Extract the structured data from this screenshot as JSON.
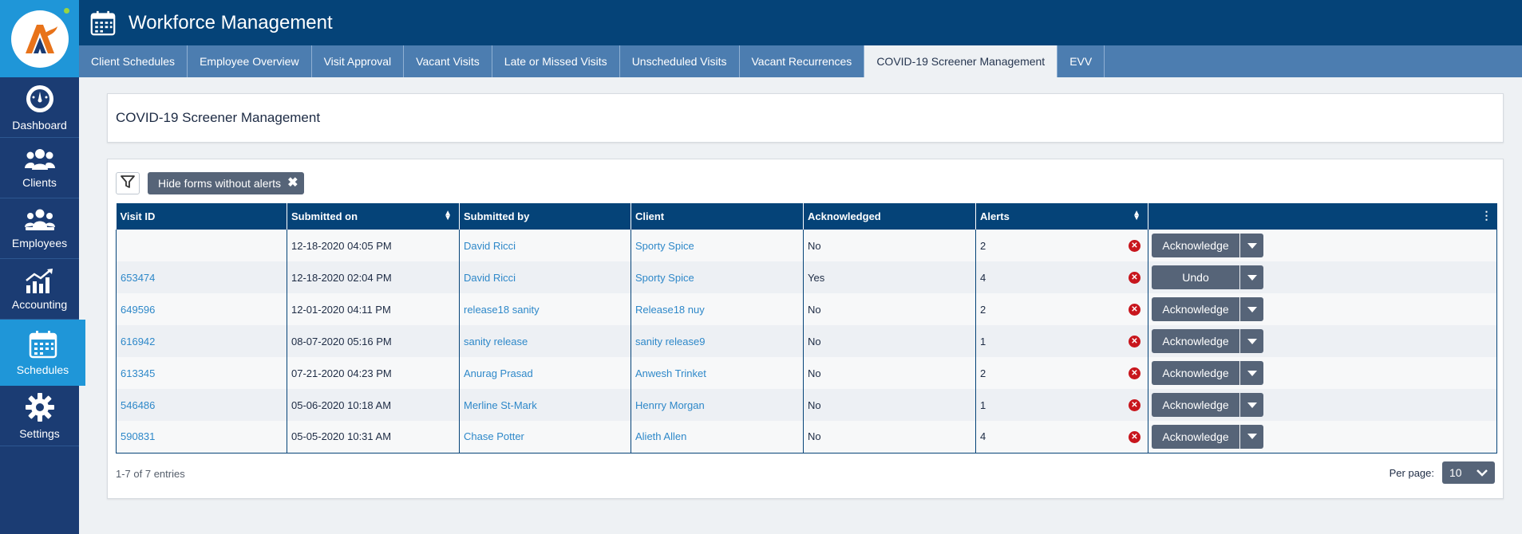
{
  "app": {
    "title": "Workforce Management"
  },
  "sidebar": {
    "items": [
      {
        "label": "Dashboard",
        "icon": "dashboard-gauge-icon"
      },
      {
        "label": "Clients",
        "icon": "clients-group-icon"
      },
      {
        "label": "Employees",
        "icon": "employees-group-icon"
      },
      {
        "label": "Accounting",
        "icon": "accounting-chart-icon"
      },
      {
        "label": "Schedules",
        "icon": "calendar-icon",
        "active": true
      },
      {
        "label": "Settings",
        "icon": "gear-icon"
      }
    ]
  },
  "tabs": [
    {
      "label": "Client Schedules"
    },
    {
      "label": "Employee Overview"
    },
    {
      "label": "Visit Approval"
    },
    {
      "label": "Vacant Visits"
    },
    {
      "label": "Late or Missed Visits"
    },
    {
      "label": "Unscheduled Visits"
    },
    {
      "label": "Vacant Recurrences"
    },
    {
      "label": "COVID-19 Screener Management",
      "active": true
    },
    {
      "label": "EVV"
    }
  ],
  "page": {
    "title": "COVID-19 Screener Management"
  },
  "filter": {
    "chip_label": "Hide forms without alerts",
    "chip_close": "✖"
  },
  "table": {
    "columns": [
      "Visit ID",
      "Submitted on",
      "Submitted by",
      "Client",
      "Acknowledged",
      "Alerts",
      ""
    ],
    "rows": [
      {
        "visit_id": "",
        "submitted_on": "12-18-2020 04:05 PM",
        "submitted_by": "David Ricci",
        "client": "Sporty Spice",
        "acknowledged": "No",
        "alerts": "2",
        "action": "Acknowledge"
      },
      {
        "visit_id": "653474",
        "submitted_on": "12-18-2020 02:04 PM",
        "submitted_by": "David Ricci",
        "client": "Sporty Spice",
        "acknowledged": "Yes",
        "alerts": "4",
        "action": "Undo"
      },
      {
        "visit_id": "649596",
        "submitted_on": "12-01-2020 04:11 PM",
        "submitted_by": "release18 sanity",
        "client": "Release18 nuy",
        "acknowledged": "No",
        "alerts": "2",
        "action": "Acknowledge"
      },
      {
        "visit_id": "616942",
        "submitted_on": "08-07-2020 05:16 PM",
        "submitted_by": "sanity release",
        "client": "sanity release9",
        "acknowledged": "No",
        "alerts": "1",
        "action": "Acknowledge"
      },
      {
        "visit_id": "613345",
        "submitted_on": "07-21-2020 04:23 PM",
        "submitted_by": "Anurag Prasad",
        "client": "Anwesh Trinket",
        "acknowledged": "No",
        "alerts": "2",
        "action": "Acknowledge"
      },
      {
        "visit_id": "546486",
        "submitted_on": "05-06-2020 10:18 AM",
        "submitted_by": "Merline St-Mark",
        "client": "Henrry Morgan",
        "acknowledged": "No",
        "alerts": "1",
        "action": "Acknowledge"
      },
      {
        "visit_id": "590831",
        "submitted_on": "05-05-2020 10:31 AM",
        "submitted_by": "Chase Potter",
        "client": "Alieth Allen",
        "acknowledged": "No",
        "alerts": "4",
        "action": "Acknowledge"
      }
    ]
  },
  "footer": {
    "entries_text": "1-7 of 7 entries",
    "per_page_label": "Per page:",
    "per_page_value": "10"
  },
  "colors": {
    "header": "#054378",
    "tabs": "#4c7db0",
    "sidebar": "#1b3c73",
    "sidebar_active": "#1f96d8",
    "button": "#566478",
    "link": "#2e88c9",
    "alert": "#c8161d"
  }
}
